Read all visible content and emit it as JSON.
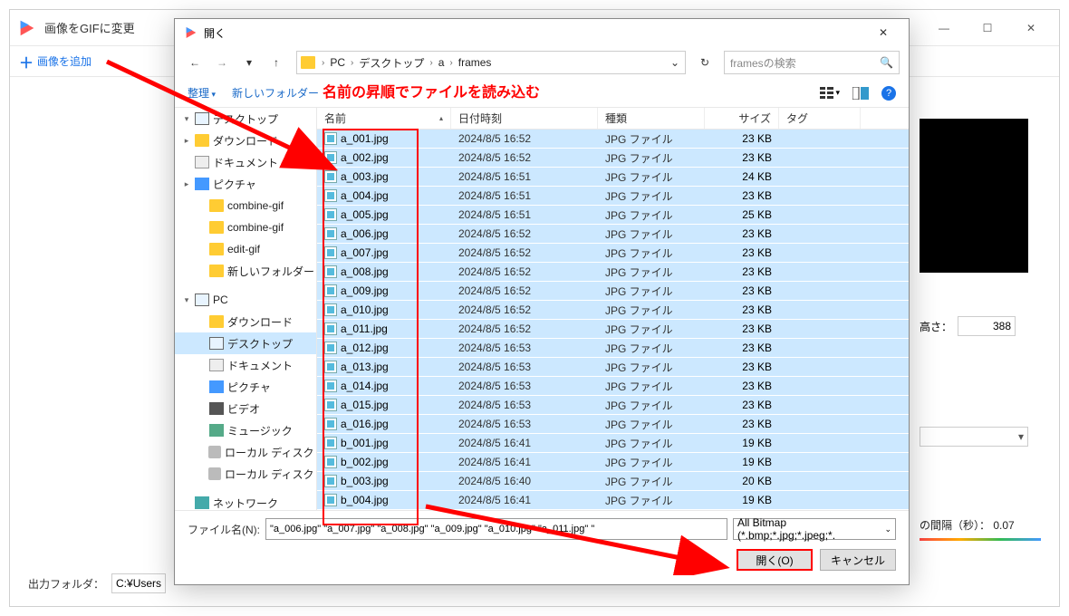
{
  "bg": {
    "title": "画像をGIFに変更",
    "add_image": "画像を追加",
    "height_label": "高さ：",
    "height_value": "388",
    "interval_label": "の間隔（秒）：",
    "interval_value": "0.07",
    "output_label": "出力フォルダ：",
    "output_path": "C:¥Users¥"
  },
  "dlg": {
    "title": "開く",
    "crumbs": [
      "PC",
      "デスクトップ",
      "a",
      "frames"
    ],
    "search_placeholder": "framesの検索",
    "organize": "整理",
    "newfolder": "新しいフォルダー",
    "headers": {
      "name": "名前",
      "date": "日付時刻",
      "type": "種類",
      "size": "サイズ",
      "tag": "タグ"
    },
    "tree": [
      {
        "label": "デスクトップ",
        "ico": "mon",
        "exp": "▾",
        "indent": false
      },
      {
        "label": "ダウンロード",
        "ico": "folder",
        "exp": "▸",
        "indent": false
      },
      {
        "label": "ドキュメント",
        "ico": "doc",
        "exp": "",
        "indent": false
      },
      {
        "label": "ピクチャ",
        "ico": "img",
        "exp": "▸",
        "indent": false
      },
      {
        "label": "combine-gif",
        "ico": "folder",
        "exp": "",
        "indent": true
      },
      {
        "label": "combine-gif",
        "ico": "folder",
        "exp": "",
        "indent": true
      },
      {
        "label": "edit-gif",
        "ico": "folder",
        "exp": "",
        "indent": true
      },
      {
        "label": "新しいフォルダー",
        "ico": "folder",
        "exp": "",
        "indent": true
      },
      {
        "label": "",
        "spacer": true
      },
      {
        "label": "PC",
        "ico": "mon",
        "exp": "▾",
        "indent": false
      },
      {
        "label": "ダウンロード",
        "ico": "folder",
        "exp": "",
        "indent": true
      },
      {
        "label": "デスクトップ",
        "ico": "mon",
        "exp": "",
        "indent": true,
        "active": true
      },
      {
        "label": "ドキュメント",
        "ico": "doc",
        "exp": "",
        "indent": true
      },
      {
        "label": "ピクチャ",
        "ico": "img",
        "exp": "",
        "indent": true
      },
      {
        "label": "ビデオ",
        "ico": "vid",
        "exp": "",
        "indent": true
      },
      {
        "label": "ミュージック",
        "ico": "mus",
        "exp": "",
        "indent": true
      },
      {
        "label": "ローカル ディスク (C",
        "ico": "disk",
        "exp": "",
        "indent": true
      },
      {
        "label": "ローカル ディスク (D",
        "ico": "disk",
        "exp": "",
        "indent": true
      },
      {
        "label": "",
        "spacer": true
      },
      {
        "label": "ネットワーク",
        "ico": "net",
        "exp": "",
        "indent": false
      }
    ],
    "files": [
      {
        "name": "a_001.jpg",
        "date": "2024/8/5 16:52",
        "type": "JPG ファイル",
        "size": "23 KB"
      },
      {
        "name": "a_002.jpg",
        "date": "2024/8/5 16:52",
        "type": "JPG ファイル",
        "size": "23 KB"
      },
      {
        "name": "a_003.jpg",
        "date": "2024/8/5 16:51",
        "type": "JPG ファイル",
        "size": "24 KB"
      },
      {
        "name": "a_004.jpg",
        "date": "2024/8/5 16:51",
        "type": "JPG ファイル",
        "size": "23 KB"
      },
      {
        "name": "a_005.jpg",
        "date": "2024/8/5 16:51",
        "type": "JPG ファイル",
        "size": "25 KB"
      },
      {
        "name": "a_006.jpg",
        "date": "2024/8/5 16:52",
        "type": "JPG ファイル",
        "size": "23 KB"
      },
      {
        "name": "a_007.jpg",
        "date": "2024/8/5 16:52",
        "type": "JPG ファイル",
        "size": "23 KB"
      },
      {
        "name": "a_008.jpg",
        "date": "2024/8/5 16:52",
        "type": "JPG ファイル",
        "size": "23 KB"
      },
      {
        "name": "a_009.jpg",
        "date": "2024/8/5 16:52",
        "type": "JPG ファイル",
        "size": "23 KB"
      },
      {
        "name": "a_010.jpg",
        "date": "2024/8/5 16:52",
        "type": "JPG ファイル",
        "size": "23 KB"
      },
      {
        "name": "a_011.jpg",
        "date": "2024/8/5 16:52",
        "type": "JPG ファイル",
        "size": "23 KB"
      },
      {
        "name": "a_012.jpg",
        "date": "2024/8/5 16:53",
        "type": "JPG ファイル",
        "size": "23 KB"
      },
      {
        "name": "a_013.jpg",
        "date": "2024/8/5 16:53",
        "type": "JPG ファイル",
        "size": "23 KB"
      },
      {
        "name": "a_014.jpg",
        "date": "2024/8/5 16:53",
        "type": "JPG ファイル",
        "size": "23 KB"
      },
      {
        "name": "a_015.jpg",
        "date": "2024/8/5 16:53",
        "type": "JPG ファイル",
        "size": "23 KB"
      },
      {
        "name": "a_016.jpg",
        "date": "2024/8/5 16:53",
        "type": "JPG ファイル",
        "size": "23 KB"
      },
      {
        "name": "b_001.jpg",
        "date": "2024/8/5 16:41",
        "type": "JPG ファイル",
        "size": "19 KB"
      },
      {
        "name": "b_002.jpg",
        "date": "2024/8/5 16:41",
        "type": "JPG ファイル",
        "size": "19 KB"
      },
      {
        "name": "b_003.jpg",
        "date": "2024/8/5 16:40",
        "type": "JPG ファイル",
        "size": "20 KB"
      },
      {
        "name": "b_004.jpg",
        "date": "2024/8/5 16:41",
        "type": "JPG ファイル",
        "size": "19 KB"
      }
    ],
    "filename_label": "ファイル名(N):",
    "filename_value": "\"a_006.jpg\" \"a_007.jpg\" \"a_008.jpg\" \"a_009.jpg\" \"a_010.jpg\" \"a_011.jpg\" \"",
    "filter_value": "All Bitmap (*.bmp;*.jpg;*.jpeg;*.",
    "open_btn": "開く(O)",
    "cancel_btn": "キャンセル"
  },
  "anno": {
    "text": "名前の昇順でファイルを読み込む"
  }
}
